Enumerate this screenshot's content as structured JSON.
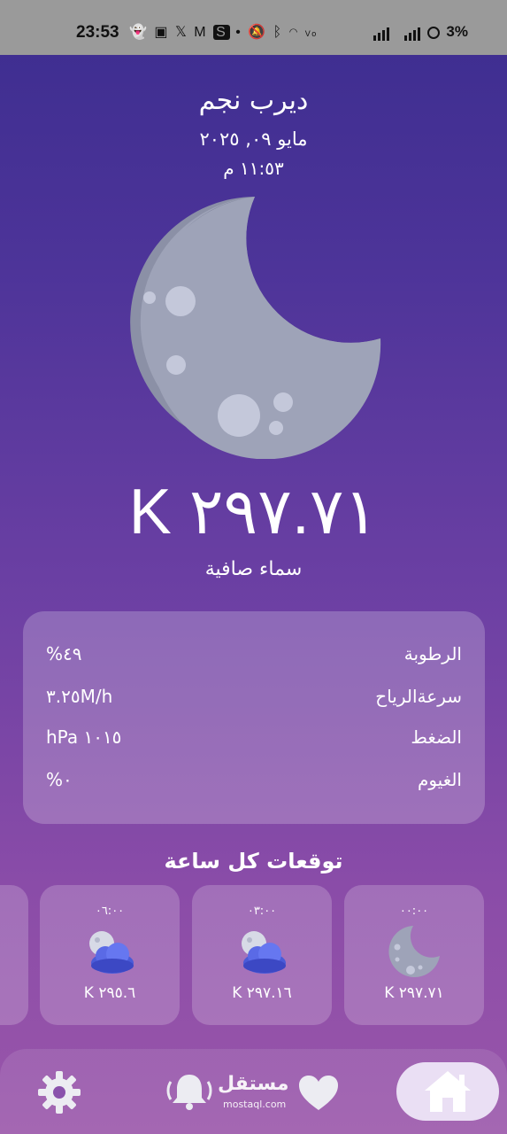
{
  "status_bar": {
    "time": "23:53",
    "battery": "3%",
    "icons": [
      "snapchat-icon",
      "youtube-icon",
      "x-icon",
      "gmail-icon",
      "s-icon",
      "dot-icon",
      "mute-icon",
      "bluetooth-icon",
      "wifi-icon",
      "volte-icon",
      "signal-icon",
      "signal-icon",
      "battery-saver-icon"
    ]
  },
  "weather": {
    "city": "ديرب نجم",
    "date": "مايو ٠٩, ٢٠٢٥",
    "time": "١١:٥٣ م",
    "temperature": "K ٢٩٧.٧١",
    "condition": "سماء صافية",
    "icon": "crescent-moon-icon"
  },
  "details": [
    {
      "label": "الرطوبة",
      "value": "%٤٩"
    },
    {
      "label": "سرعةالرياح",
      "value": "٣.٢٥M/h"
    },
    {
      "label": "الضغط",
      "value": "hPa ١٠١٥"
    },
    {
      "label": "الغيوم",
      "value": "%٠"
    }
  ],
  "forecast": {
    "title": "توقعات كل ساعة",
    "items": [
      {
        "time": "٠٠:٠٠",
        "temp": "K ٢٩٧.٧١",
        "icon": "crescent-moon-icon"
      },
      {
        "time": "٠٣:٠٠",
        "temp": "K ٢٩٧.١٦",
        "icon": "cloudy-night-icon"
      },
      {
        "time": "٠٦:٠٠",
        "temp": "K ٢٩٥.٦",
        "icon": "cloudy-night-icon"
      }
    ]
  },
  "nav": {
    "items": [
      "home-icon",
      "heart-icon",
      "bell-icon",
      "gear-icon"
    ],
    "watermark": "مستقل",
    "watermark_sub": "mostaql.com"
  },
  "colors": {
    "accent_pill": "#eadff4",
    "moon": "#9aa0b4"
  }
}
